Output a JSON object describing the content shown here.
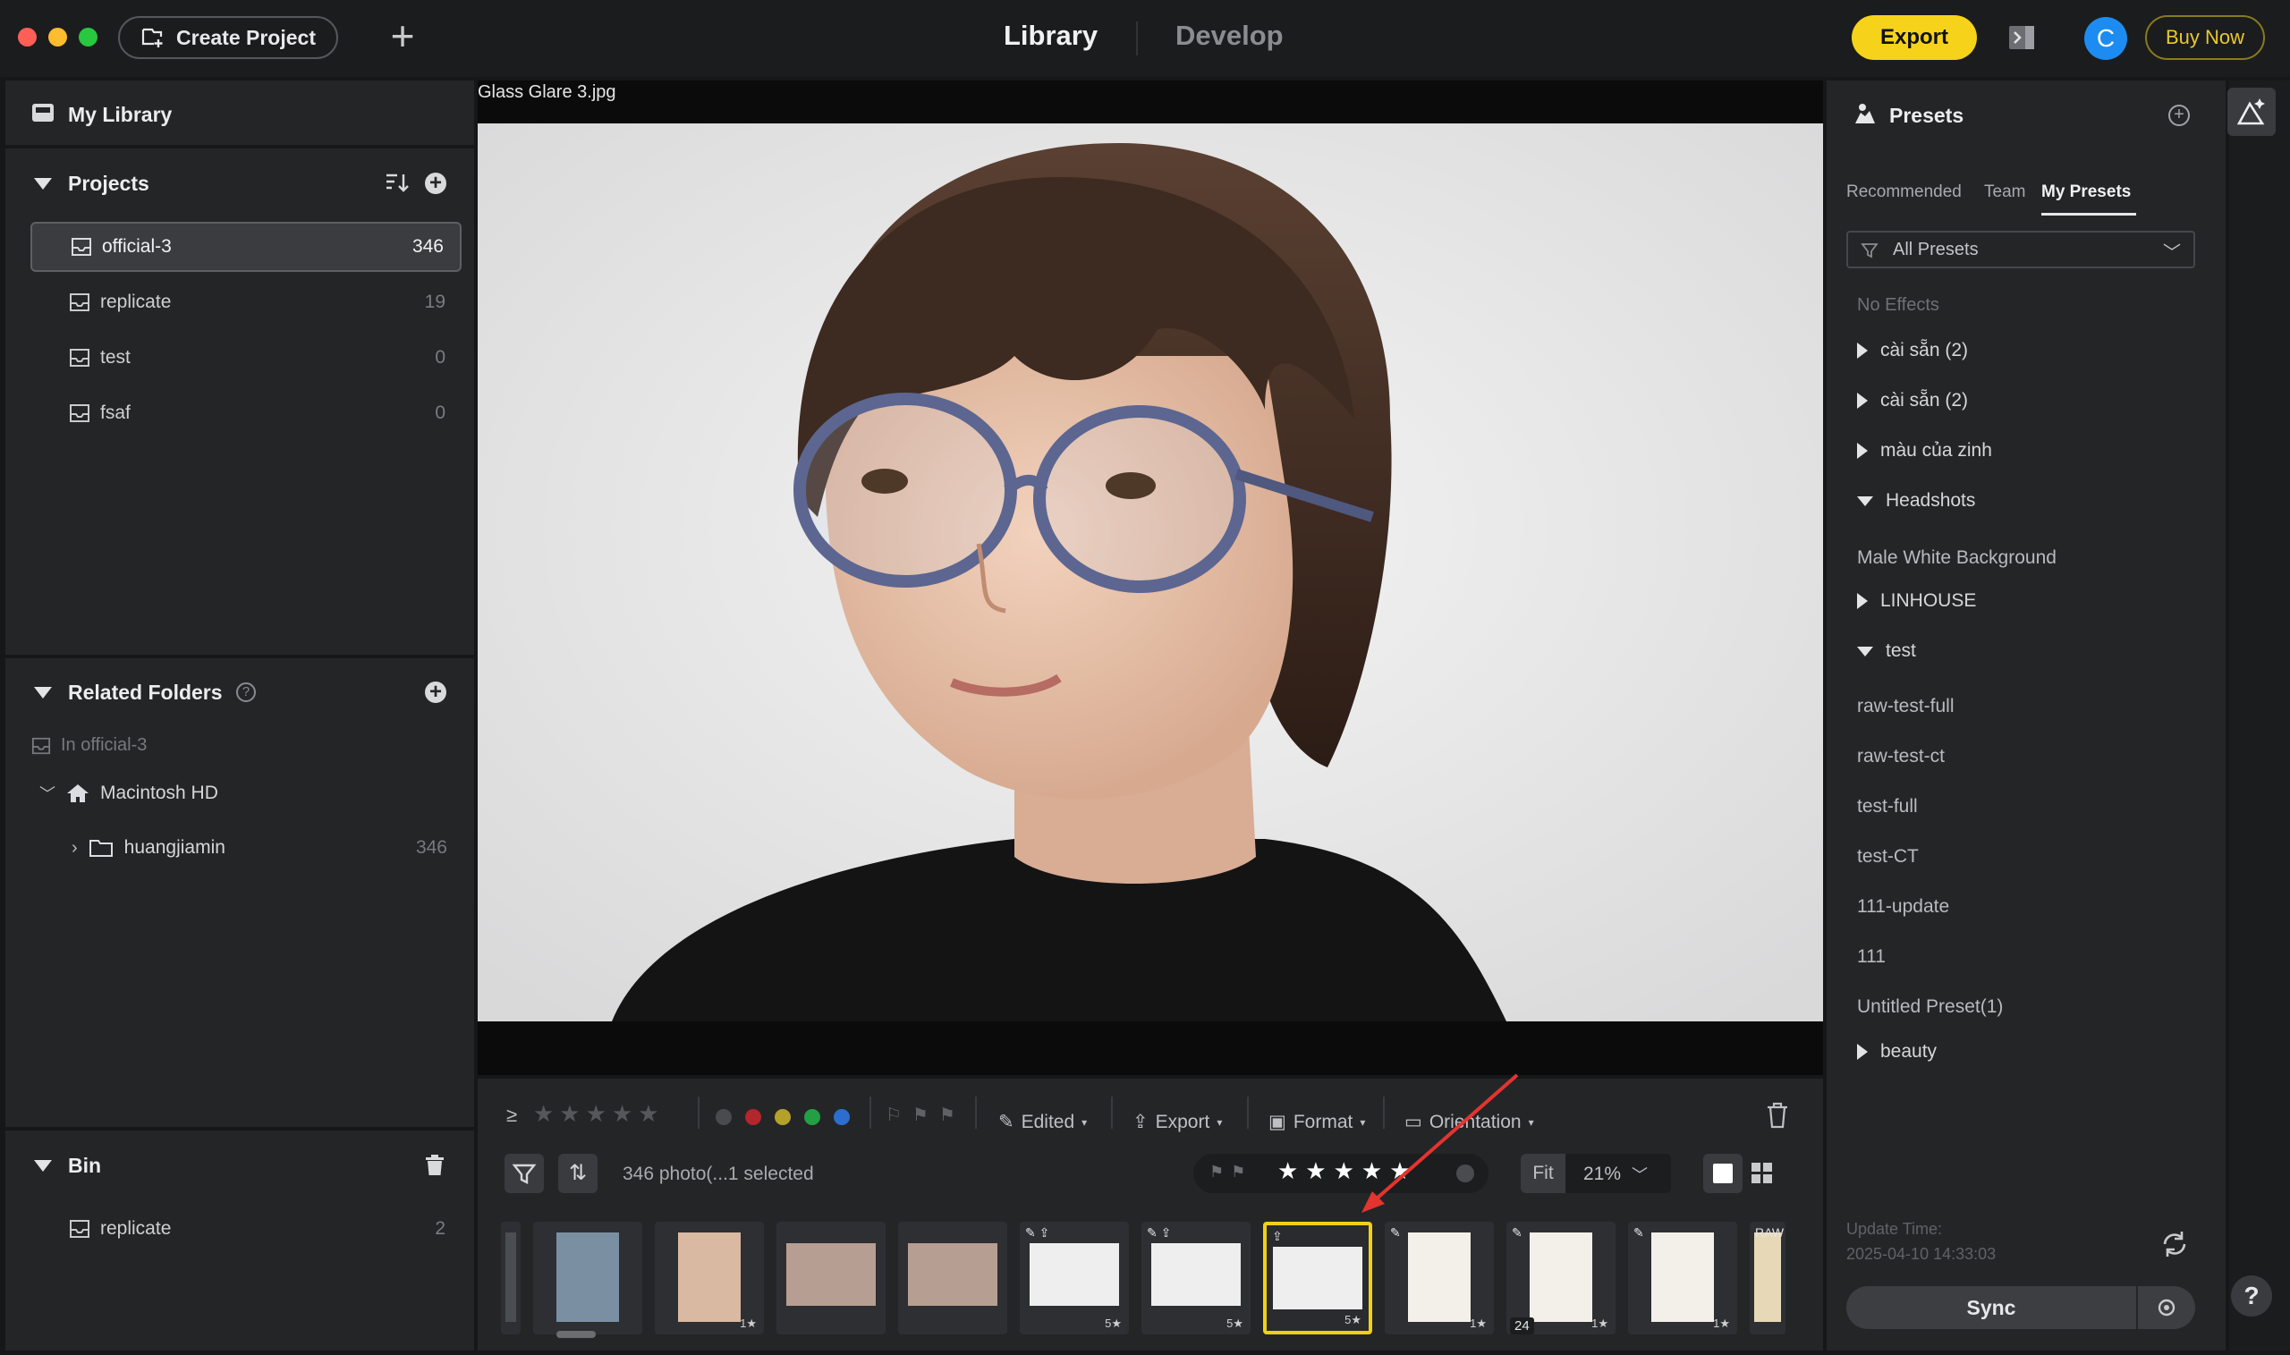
{
  "titlebar": {
    "create_project": "Create Project",
    "tabs": [
      "Library",
      "Develop"
    ],
    "export": "Export",
    "avatar_letter": "C",
    "buy_now": "Buy Now"
  },
  "left": {
    "my_library": "My Library",
    "projects_title": "Projects",
    "projects": [
      {
        "name": "official-3",
        "count": "346"
      },
      {
        "name": "replicate",
        "count": "19"
      },
      {
        "name": "test",
        "count": "0"
      },
      {
        "name": "fsaf",
        "count": "0"
      }
    ],
    "related_title": "Related Folders",
    "in_project": "In official-3",
    "volume": "Macintosh HD",
    "folder": {
      "name": "huangjiamin",
      "count": "346"
    },
    "bin_title": "Bin",
    "bin_items": [
      {
        "name": "replicate",
        "count": "2"
      }
    ]
  },
  "viewer": {
    "filename": "Glass Glare 3.jpg"
  },
  "toolbar": {
    "edited": "Edited",
    "export": "Export",
    "format": "Format",
    "orientation": "Orientation",
    "photo_count": "346 photo(...1 selected",
    "fit": "Fit",
    "zoom": "21%",
    "label_colors": [
      "#4a4b4e",
      "#b3262c",
      "#b4a12a",
      "#22a043",
      "#2b6ed0"
    ],
    "rating_filter": "≥"
  },
  "filmstrip": [
    {
      "label": "",
      "icons": "",
      "bg": "#4a4d52",
      "w": 0
    },
    {
      "label": "",
      "icons": "",
      "bg": "#7b8fa3"
    },
    {
      "label": "1★",
      "icons": "",
      "bg": "#d9b9a1"
    },
    {
      "label": "",
      "icons": "",
      "bg": "#b79e93"
    },
    {
      "label": "",
      "icons": "",
      "bg": "#b79e93"
    },
    {
      "label": "5★",
      "icons": "✎ ⇪",
      "bg": "#eeeeee"
    },
    {
      "label": "5★",
      "icons": "✎ ⇪",
      "bg": "#eeeeee"
    },
    {
      "label": "5★",
      "icons": "⇪",
      "bg": "#eeeeee",
      "selected": true
    },
    {
      "label": "1★",
      "icons": "✎",
      "bg": "#f3efe9"
    },
    {
      "label": "1★",
      "icons": "✎",
      "bg": "#f3efe9",
      "badge": "24"
    },
    {
      "label": "1★",
      "icons": "✎",
      "bg": "#f3efe9"
    },
    {
      "label": "",
      "icons": "RAW",
      "bg": "#e7d9b8"
    }
  ],
  "presets": {
    "title": "Presets",
    "tabs": [
      "Recommended",
      "Team",
      "My Presets"
    ],
    "dropdown": "All Presets",
    "no_effects": "No Effects",
    "items": [
      {
        "name": "cài sẵn (2)",
        "type": "collapsed"
      },
      {
        "name": "cài sẵn (2)",
        "type": "collapsed"
      },
      {
        "name": "màu của zinh",
        "type": "collapsed"
      },
      {
        "name": "Headshots",
        "type": "expanded"
      },
      {
        "name": "Male White Background",
        "type": "plain"
      },
      {
        "name": "LINHOUSE",
        "type": "collapsed"
      },
      {
        "name": "test",
        "type": "expanded"
      },
      {
        "name": "raw-test-full",
        "type": "plain"
      },
      {
        "name": "raw-test-ct",
        "type": "plain"
      },
      {
        "name": "test-full",
        "type": "plain"
      },
      {
        "name": "test-CT",
        "type": "plain"
      },
      {
        "name": "111-update",
        "type": "plain"
      },
      {
        "name": "111",
        "type": "plain"
      },
      {
        "name": "Untitled Preset(1)",
        "type": "plain"
      },
      {
        "name": "beauty",
        "type": "collapsed"
      }
    ],
    "update_label": "Update Time:",
    "update_time": "2025-04-10 14:33:03",
    "sync": "Sync"
  },
  "help": "?"
}
